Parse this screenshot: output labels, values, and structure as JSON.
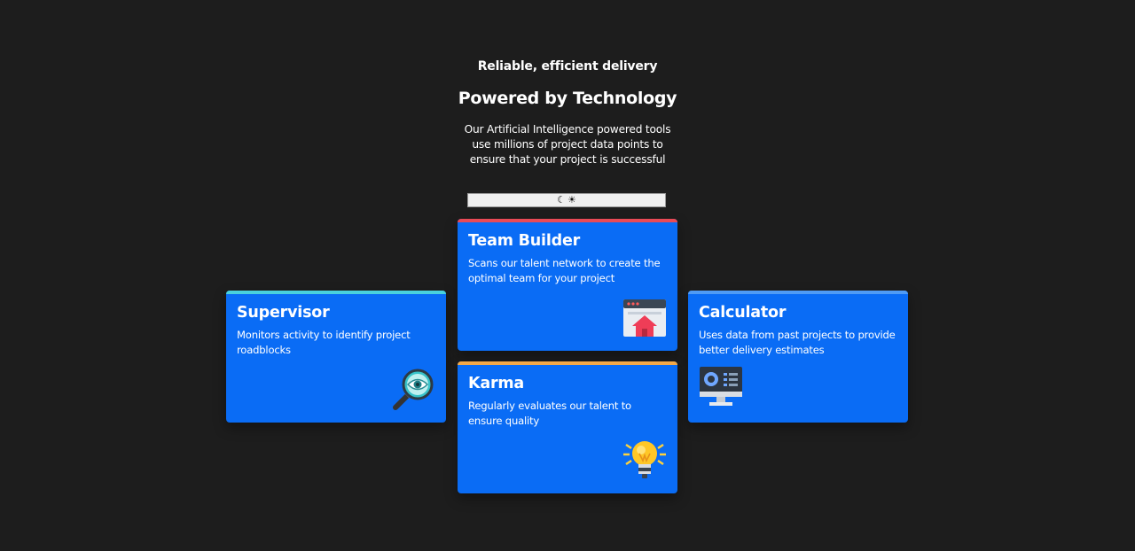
{
  "header": {
    "subtitle": "Reliable, efficient delivery",
    "title": "Powered by Technology",
    "intro": "Our Artificial Intelligence powered tools use millions of project data points to ensure that your project is successful"
  },
  "theme_toggle": {
    "moon": "☾",
    "sun": "☀"
  },
  "cards": {
    "supervisor": {
      "title": "Supervisor",
      "text": "Monitors activity to identify project roadblocks",
      "icon": "magnifier-eye-icon",
      "accent": "#49d2dd"
    },
    "team_builder": {
      "title": "Team Builder",
      "text": "Scans our talent network to create the optimal team for your project",
      "icon": "team-builder-icon",
      "accent": "#e94a56"
    },
    "karma": {
      "title": "Karma",
      "text": "Regularly evaluates our talent to ensure quality",
      "icon": "lightbulb-icon",
      "accent": "#f4a947"
    },
    "calculator": {
      "title": "Calculator",
      "text": "Uses data from past projects to provide better delivery estimates",
      "icon": "monitor-chart-icon",
      "accent": "#4f9bf5"
    }
  },
  "colors": {
    "background": "#1d1d1d",
    "card": "#0a6cf5"
  }
}
